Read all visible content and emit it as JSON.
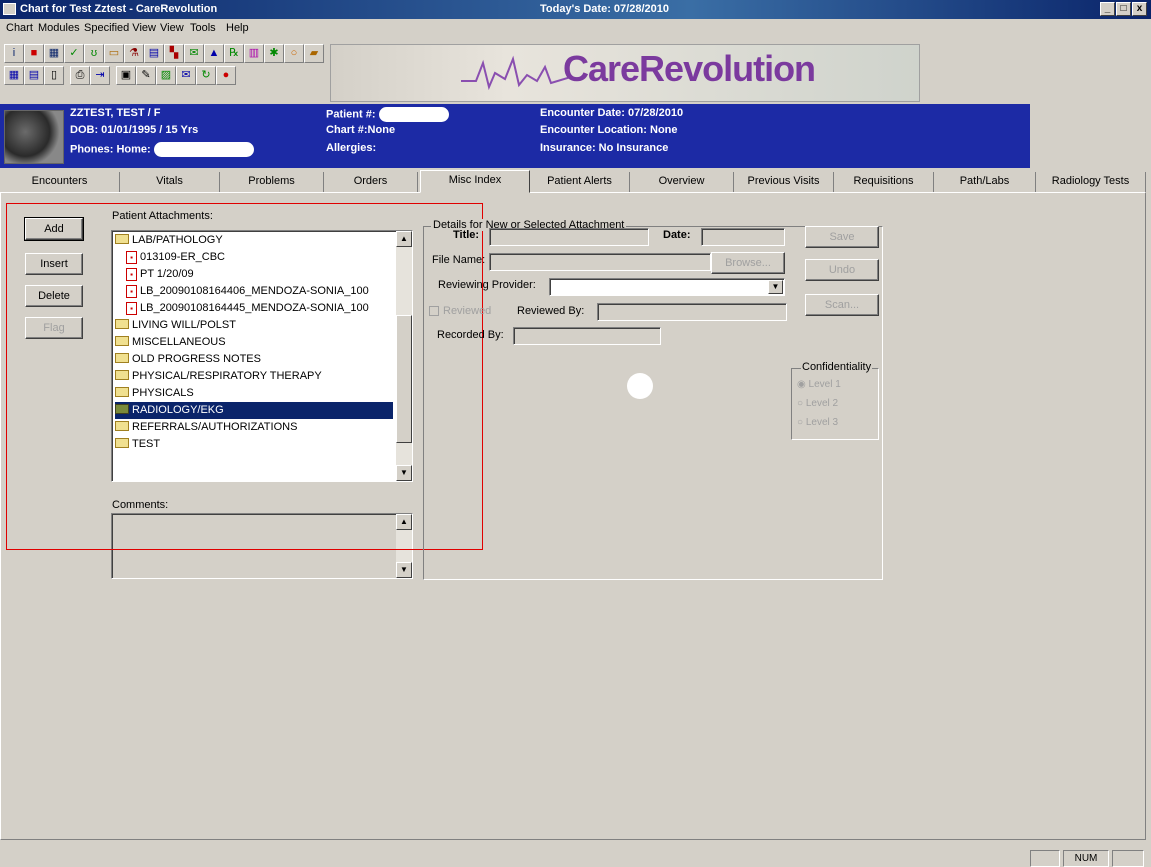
{
  "window": {
    "title": "Chart for Test Zztest - CareRevolution",
    "today": "Today's Date: 07/28/2010",
    "controls": [
      "_",
      "□",
      "x"
    ]
  },
  "menu": [
    "Chart",
    "Modules",
    "Specified View",
    "View",
    "Tools",
    "Help"
  ],
  "logo": {
    "text": "CareRevolution"
  },
  "patient": {
    "name": "ZZTEST, TEST / F",
    "dob": "DOB:  01/01/1995 / 15 Yrs",
    "phones": "Phones: Home:",
    "patient_no": "Patient #:",
    "chart_no": "Chart #:None",
    "allergies": "Allergies:",
    "encounter_date": "Encounter Date:  07/28/2010",
    "encounter_location": "Encounter Location:  None",
    "insurance": "Insurance: No Insurance"
  },
  "tabs": [
    "Encounters",
    "Vitals",
    "Problems",
    "Orders",
    "Misc Index",
    "Patient Alerts",
    "Overview",
    "Previous Visits",
    "Requisitions",
    "Path/Labs",
    "Radiology Tests"
  ],
  "active_tab": "Misc Index",
  "buttons": {
    "add": "Add",
    "insert": "Insert",
    "delete": "Delete",
    "flag": "Flag"
  },
  "attachments": {
    "label": "Patient Attachments:",
    "items": [
      {
        "label": "LAB/PATHOLOGY",
        "type": "folder-open"
      },
      {
        "label": "013109-ER_CBC",
        "type": "pdf"
      },
      {
        "label": "PT 1/20/09",
        "type": "pdf"
      },
      {
        "label": "LB_20090108164406_MENDOZA-SONIA_100",
        "type": "pdf"
      },
      {
        "label": "LB_20090108164445_MENDOZA-SONIA_100",
        "type": "pdf"
      },
      {
        "label": "LIVING WILL/POLST",
        "type": "folder"
      },
      {
        "label": "MISCELLANEOUS",
        "type": "folder"
      },
      {
        "label": "OLD PROGRESS NOTES",
        "type": "folder"
      },
      {
        "label": "PHYSICAL/RESPIRATORY THERAPY",
        "type": "folder"
      },
      {
        "label": "PHYSICALS",
        "type": "folder"
      },
      {
        "label": "RADIOLOGY/EKG",
        "type": "folder-selected"
      },
      {
        "label": "REFERRALS/AUTHORIZATIONS",
        "type": "folder"
      },
      {
        "label": "TEST",
        "type": "folder"
      }
    ],
    "comments_label": "Comments:"
  },
  "details": {
    "group": "Details for New or Selected Attachment",
    "title": "Title:",
    "date": "Date:",
    "file_name": "File Name:",
    "browse": "Browse...",
    "reviewing_provider": "Reviewing Provider:",
    "reviewed": "Reviewed",
    "reviewed_by": "Reviewed By:",
    "recorded_by": "Recorded By:",
    "save": "Save",
    "undo": "Undo",
    "scan": "Scan...",
    "confidentiality": "Confidentiality",
    "levels": [
      "Level 1",
      "Level 2",
      "Level 3"
    ]
  },
  "status": {
    "num": "NUM"
  }
}
